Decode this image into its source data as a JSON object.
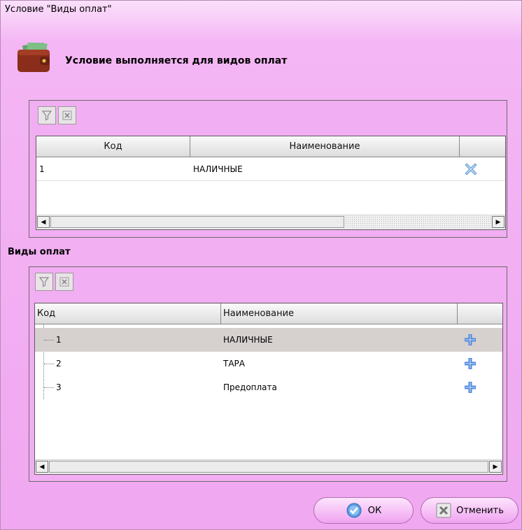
{
  "window": {
    "title": "Условие \"Виды оплат\""
  },
  "heading": "Условие выполняется для видов оплат",
  "selected_grid": {
    "columns": [
      "Код",
      "Наименование",
      ""
    ],
    "rows": [
      {
        "code": "1",
        "name": "НАЛИЧНЫЕ"
      }
    ]
  },
  "available": {
    "label": "Виды оплат",
    "columns": [
      "Код",
      "Наименование",
      ""
    ],
    "rows": [
      {
        "code": "1",
        "name": "НАЛИЧНЫЕ"
      },
      {
        "code": "2",
        "name": "ТАРА"
      },
      {
        "code": "3",
        "name": "Предоплата"
      }
    ]
  },
  "buttons": {
    "ok": "ОК",
    "cancel": "Отменить"
  },
  "colors": {
    "background": "#f0a8f0",
    "selected_row": "#d6d0cf",
    "plus_icon": "#4f86d8"
  }
}
